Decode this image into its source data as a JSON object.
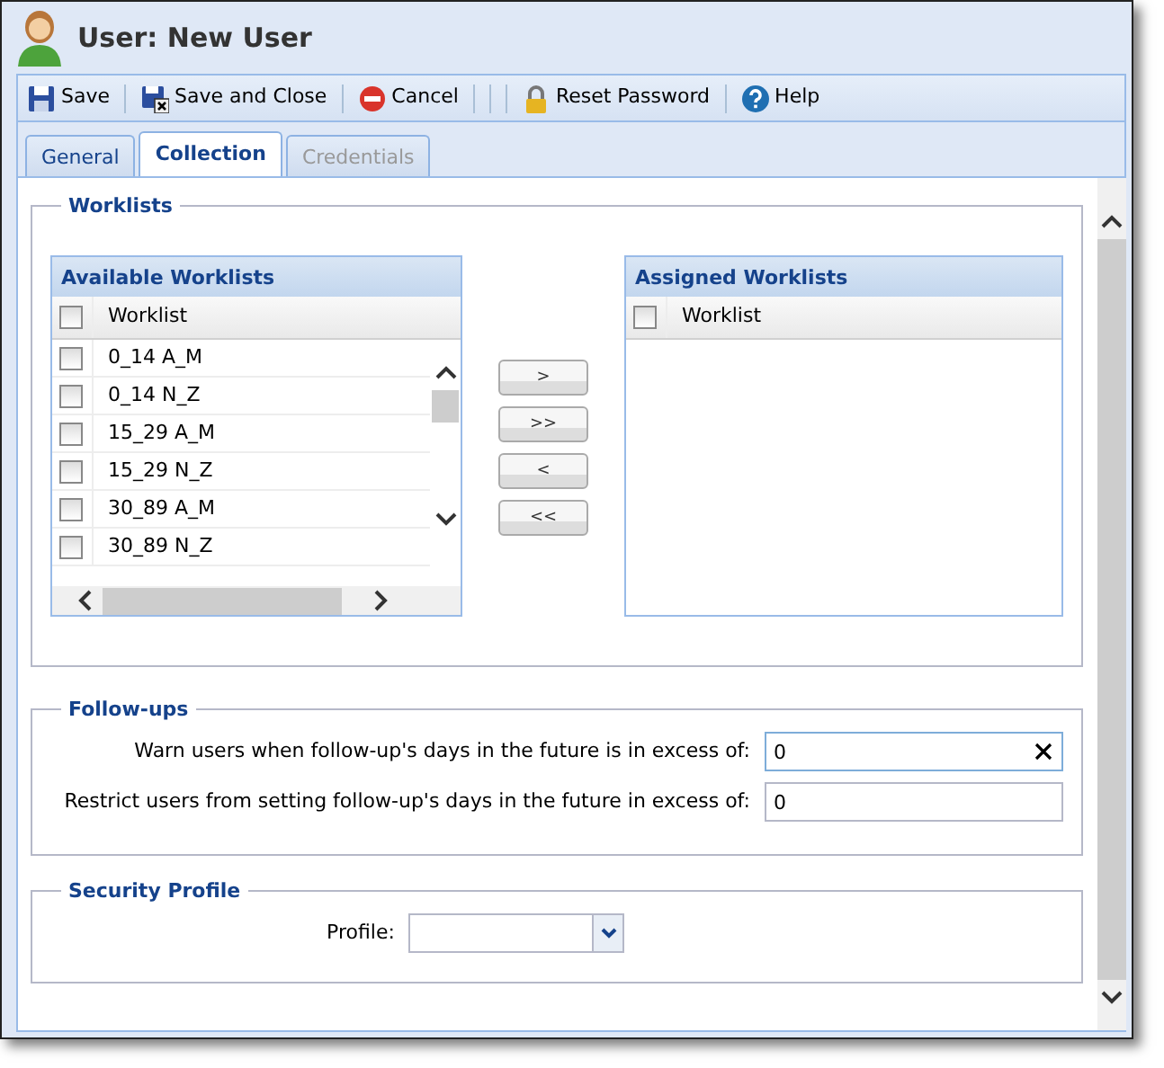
{
  "window": {
    "title": "User: New User"
  },
  "toolbar": [
    {
      "kind": "save",
      "label": "Save"
    },
    {
      "kind": "separator"
    },
    {
      "kind": "save-close",
      "label": "Save and Close"
    },
    {
      "kind": "separator"
    },
    {
      "kind": "cancel",
      "label": "Cancel"
    },
    {
      "kind": "separator"
    },
    {
      "kind": "separator"
    },
    {
      "kind": "separator"
    },
    {
      "kind": "lock",
      "label": "Reset Password"
    },
    {
      "kind": "separator"
    },
    {
      "kind": "help",
      "label": "Help"
    }
  ],
  "tabs": [
    {
      "label": "General",
      "selected": false,
      "disabled": false
    },
    {
      "label": "Collection",
      "selected": true,
      "disabled": false
    },
    {
      "label": "Credentials",
      "selected": false,
      "disabled": true
    }
  ],
  "worklists": {
    "legend": "Worklists",
    "available": {
      "title": "Available Worklists",
      "column": "Worklist",
      "header_checked": false,
      "rows": [
        {
          "label": "0_14 A_M",
          "checked": false
        },
        {
          "label": "0_14 N_Z",
          "checked": false
        },
        {
          "label": "15_29 A_M",
          "checked": false
        },
        {
          "label": "15_29 N_Z",
          "checked": false
        },
        {
          "label": "30_89 A_M",
          "checked": false
        },
        {
          "label": "30_89 N_Z",
          "checked": false
        }
      ]
    },
    "move_buttons": [
      ">",
      ">>",
      "<",
      "<<"
    ],
    "assigned": {
      "title": "Assigned Worklists",
      "column": "Worklist",
      "header_checked": false
    }
  },
  "followups": {
    "legend": "Follow-ups",
    "fields": [
      {
        "label": "Warn users when follow-up's days in the future is in excess of:",
        "value": "0",
        "focused": true
      },
      {
        "label": "Restrict users from setting follow-up's days in the future in excess of:",
        "value": "0",
        "focused": false
      }
    ]
  },
  "security": {
    "legend": "Security Profile",
    "profile_label": "Profile:"
  }
}
